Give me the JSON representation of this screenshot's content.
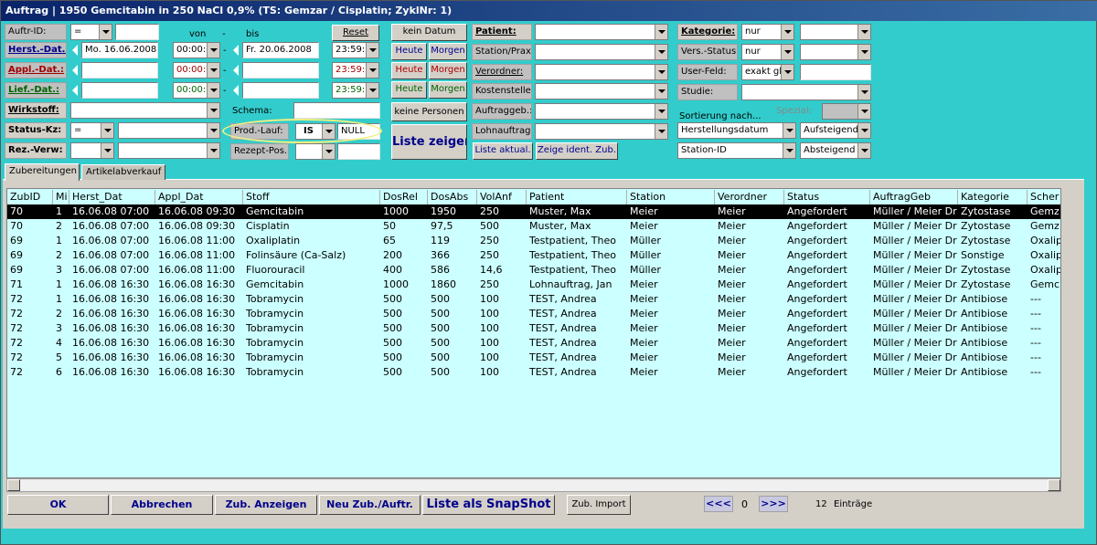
{
  "window": {
    "title": "Auftrag | 1950 Gemcitabin in 250 NaCl 0,9% (TS: Gemzar / Cisplatin; ZyklNr: 1)"
  },
  "filters": {
    "auftr_id_label": "Auftr-ID:",
    "auftr_id_op": "=",
    "auftr_id_value": "",
    "herst_label": "Herst.-Dat.:",
    "appl_label": "Appl.-Dat.:",
    "lief_label": "Lief.-Dat.:",
    "von_label": "von",
    "dash": "-",
    "bis_label": "bis",
    "reset_label": "Reset",
    "herst_from_date": "Mo. 16.06.2008",
    "herst_from_time": "00:00:0",
    "herst_to_date": "Fr. 20.06.2008",
    "herst_to_time": "23:59:5",
    "appl_from_date": "",
    "appl_from_time": "00:00:0",
    "appl_to_date": "",
    "appl_to_time": "23:59:5",
    "lief_from_date": "",
    "lief_from_time": "00:00:0",
    "lief_to_date": "",
    "lief_to_time": "23:59:5",
    "wirkstoff_label": "Wirkstoff:",
    "schema_label": "Schema:",
    "status_label": "Status-Kz:",
    "status_op": "=",
    "prodlauf_label": "Prod.-Lauf:",
    "prodlauf_op": "IS",
    "prodlauf_value": "NULL",
    "rezverw_label": "Rez.-Verw:",
    "rezeptpos_label": "Rezept-Pos.:"
  },
  "date_buttons": {
    "kein_datum": "kein Datum",
    "heute": "Heute",
    "morgen": "Morgen",
    "keine_personen": "keine Personen",
    "liste_zeigen": "Liste zeigen"
  },
  "persons": {
    "patient_label": "Patient:",
    "station_label": "Station/Prax:",
    "verordner_label": "Verordner:",
    "kostenstelle_label": "Kostenstelle:",
    "auftraggeb_label": "Auftraggeb.:",
    "lohnauftrag_label": "Lohnauftrag.:",
    "liste_aktual": "Liste aktual.",
    "zeige_ident": "Zeige ident. Zub."
  },
  "categories": {
    "kategorie_label": "Kategorie:",
    "kategorie_mode": "nur",
    "vers_status_label": "Vers.-Status:",
    "vers_status_mode": "nur",
    "user_feld_label": "User-Feld:",
    "user_feld_mode": "exakt gle",
    "studie_label": "Studie:",
    "spezial_label": "Spezial:",
    "sort_label": "Sortierung nach...",
    "sort1_field": "Herstellungsdatum",
    "sort1_dir": "Aufsteigend",
    "sort2_field": "Station-ID",
    "sort2_dir": "Absteigend"
  },
  "tabs": [
    {
      "label": "Zubereitungen"
    },
    {
      "label": "Artikelabverkauf"
    }
  ],
  "table": {
    "columns": [
      "ZubID",
      "Mi",
      "Herst_Dat",
      "Appl_Dat",
      "Stoff",
      "DosRel",
      "DosAbs",
      "VolAnf",
      "Patient",
      "Station",
      "Verordner",
      "Status",
      "AuftragGeb",
      "Kategorie",
      "Scher"
    ],
    "rows": [
      [
        "70",
        "1",
        "16.06.08 07:00",
        "16.06.08 09:30",
        "Gemcitabin",
        "1000",
        "1950",
        "250",
        "Muster, Max",
        "Meier",
        "Meier",
        "Angefordert",
        "Müller / Meier Dr",
        "Zytostase",
        "Gemz"
      ],
      [
        "70",
        "2",
        "16.06.08 07:00",
        "16.06.08 09:30",
        "Cisplatin",
        "50",
        "97,5",
        "500",
        "Muster, Max",
        "Meier",
        "Meier",
        "Angefordert",
        "Müller / Meier Dr",
        "Zytostase",
        "Gemz"
      ],
      [
        "69",
        "1",
        "16.06.08 07:00",
        "16.06.08 11:00",
        "Oxaliplatin",
        "65",
        "119",
        "250",
        "Testpatient, Theo",
        "Müller",
        "Meier",
        "Angefordert",
        "Müller / Meier Dr",
        "Zytostase",
        "Oxalip"
      ],
      [
        "69",
        "2",
        "16.06.08 07:00",
        "16.06.08 11:00",
        "Folinsäure (Ca-Salz)",
        "200",
        "366",
        "250",
        "Testpatient, Theo",
        "Müller",
        "Meier",
        "Angefordert",
        "Müller / Meier Dr",
        "Sonstige",
        "Oxalip"
      ],
      [
        "69",
        "3",
        "16.06.08 07:00",
        "16.06.08 11:00",
        "Fluorouracil",
        "400",
        "586",
        "14,6",
        "Testpatient, Theo",
        "Müller",
        "Meier",
        "Angefordert",
        "Müller / Meier Dr",
        "Zytostase",
        "Oxalip"
      ],
      [
        "71",
        "1",
        "16.06.08 16:30",
        "16.06.08 16:30",
        "Gemcitabin",
        "1000",
        "1860",
        "250",
        "Lohnauftrag, Jan",
        "Meier",
        "Meier",
        "Angefordert",
        "Müller / Meier Dr",
        "Zytostase",
        "Gemc"
      ],
      [
        "72",
        "1",
        "16.06.08 16:30",
        "16.06.08 16:30",
        "Tobramycin",
        "500",
        "500",
        "100",
        "TEST, Andrea",
        "Meier",
        "Meier",
        "Angefordert",
        "Müller / Meier Dr",
        "Antibiose",
        "---"
      ],
      [
        "72",
        "2",
        "16.06.08 16:30",
        "16.06.08 16:30",
        "Tobramycin",
        "500",
        "500",
        "100",
        "TEST, Andrea",
        "Meier",
        "Meier",
        "Angefordert",
        "Müller / Meier Dr",
        "Antibiose",
        "---"
      ],
      [
        "72",
        "3",
        "16.06.08 16:30",
        "16.06.08 16:30",
        "Tobramycin",
        "500",
        "500",
        "100",
        "TEST, Andrea",
        "Meier",
        "Meier",
        "Angefordert",
        "Müller / Meier Dr",
        "Antibiose",
        "---"
      ],
      [
        "72",
        "4",
        "16.06.08 16:30",
        "16.06.08 16:30",
        "Tobramycin",
        "500",
        "500",
        "100",
        "TEST, Andrea",
        "Meier",
        "Meier",
        "Angefordert",
        "Müller / Meier Dr",
        "Antibiose",
        "---"
      ],
      [
        "72",
        "5",
        "16.06.08 16:30",
        "16.06.08 16:30",
        "Tobramycin",
        "500",
        "500",
        "100",
        "TEST, Andrea",
        "Meier",
        "Meier",
        "Angefordert",
        "Müller / Meier Dr",
        "Antibiose",
        "---"
      ],
      [
        "72",
        "6",
        "16.06.08 16:30",
        "16.06.08 16:30",
        "Tobramycin",
        "500",
        "500",
        "100",
        "TEST, Andrea",
        "Meier",
        "Meier",
        "Angefordert",
        "Müller / Meier Dr",
        "Antibiose",
        "---"
      ]
    ]
  },
  "footer": {
    "ok": "OK",
    "abbrechen": "Abbrechen",
    "zub_anzeigen": "Zub. Anzeigen",
    "neu_zub": "Neu Zub./Auftr.",
    "snapshot": "Liste als SnapShot",
    "zub_import": "Zub. Import",
    "prev": "<<<",
    "page": "0",
    "next": ">>>",
    "count": "12",
    "count_label": "Einträge"
  }
}
